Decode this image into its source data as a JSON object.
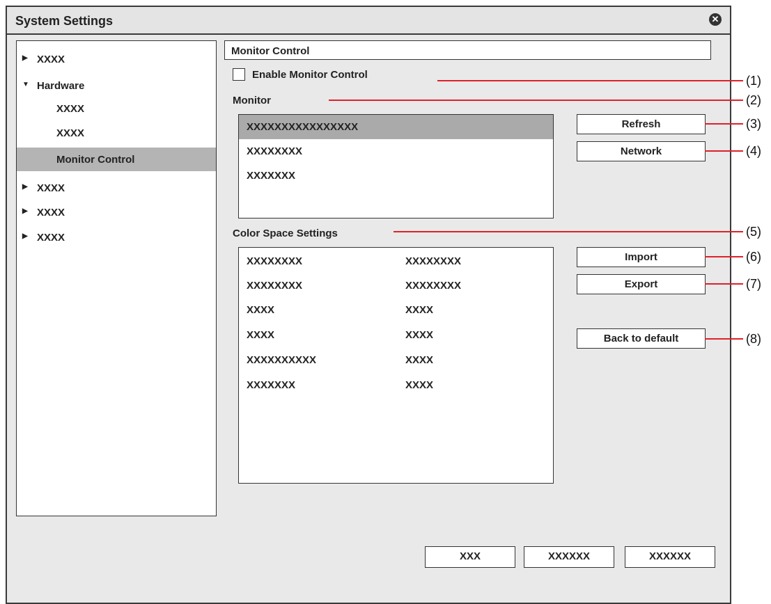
{
  "window": {
    "title": "System Settings",
    "close_icon": "close-icon"
  },
  "tree": {
    "items": [
      {
        "label": "XXXX",
        "arrow": "▶"
      },
      {
        "label": "Hardware",
        "arrow": "▼"
      },
      {
        "label": "XXXX"
      },
      {
        "label": "XXXX"
      },
      {
        "label": "Monitor Control"
      },
      {
        "label": "XXXX",
        "arrow": "▶"
      },
      {
        "label": "XXXX",
        "arrow": "▶"
      },
      {
        "label": "XXXX",
        "arrow": "▶"
      }
    ]
  },
  "panel": {
    "title": "Monitor Control",
    "enable_label": "Enable Monitor Control",
    "enable_checked": false,
    "monitor_label": "Monitor",
    "monitor_list": [
      "XXXXXXXXXXXXXXXX",
      "XXXXXXXX",
      "XXXXXXX"
    ],
    "color_space_label": "Color Space Settings",
    "color_space_rows": [
      [
        "XXXXXXXX",
        "XXXXXXXX"
      ],
      [
        "XXXXXXXX",
        "XXXXXXXX"
      ],
      [
        "XXXX",
        "XXXX"
      ],
      [
        "XXXX",
        "XXXX"
      ],
      [
        "XXXXXXXXXX",
        "XXXX"
      ],
      [
        "XXXXXXX",
        "XXXX"
      ]
    ],
    "buttons": {
      "refresh": "Refresh",
      "network": "Network",
      "import": "Import",
      "export": "Export",
      "back_to_default": "Back to default"
    }
  },
  "footer": {
    "buttons": [
      "XXX",
      "XXXXXX",
      "XXXXXX"
    ]
  },
  "callouts": [
    "(1)",
    "(2)",
    "(3)",
    "(4)",
    "(5)",
    "(6)",
    "(7)",
    "(8)"
  ],
  "colors": {
    "callout_line": "#e0202a",
    "selection": "#b4b4b4",
    "window_bg": "#e9e9e9"
  }
}
